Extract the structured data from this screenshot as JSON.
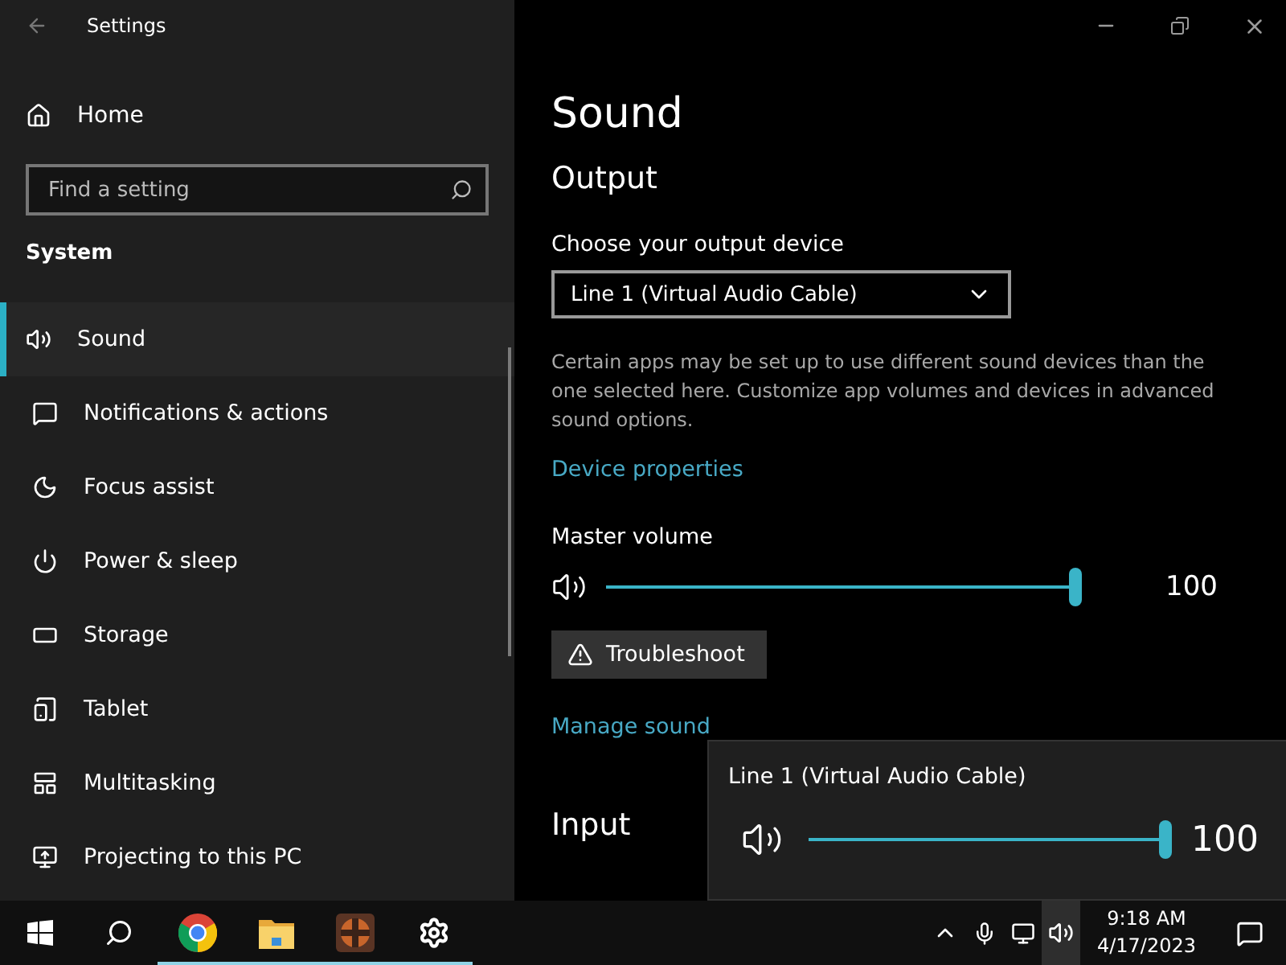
{
  "window": {
    "title": "Settings"
  },
  "sidebar": {
    "home": "Home",
    "search": {
      "placeholder": "Find a setting"
    },
    "section": "System",
    "items": [
      {
        "label": "Sound",
        "selected": true
      },
      {
        "label": "Notifications & actions",
        "selected": false
      },
      {
        "label": "Focus assist",
        "selected": false
      },
      {
        "label": "Power & sleep",
        "selected": false
      },
      {
        "label": "Storage",
        "selected": false
      },
      {
        "label": "Tablet",
        "selected": false
      },
      {
        "label": "Multitasking",
        "selected": false
      },
      {
        "label": "Projecting to this PC",
        "selected": false
      }
    ]
  },
  "main": {
    "title": "Sound",
    "output_heading": "Output",
    "device_label": "Choose your output device",
    "device_value": "Line 1 (Virtual Audio Cable)",
    "description": "Certain apps may be set up to use different sound devices than the one selected here. Customize app volumes and devices in advanced sound options.",
    "device_properties_link": "Device properties",
    "master_volume_label": "Master volume",
    "master_volume": {
      "level": 1.0,
      "reading": "100"
    },
    "troubleshoot_button": "Troubleshoot",
    "manage_link": "Manage sound",
    "input_heading": "Input"
  },
  "flyout": {
    "device": "Line 1 (Virtual Audio Cable)",
    "level": 1.0,
    "reading": "100"
  },
  "taskbar": {
    "apps": [
      {
        "kind": "start",
        "running": false
      },
      {
        "kind": "search",
        "running": false
      },
      {
        "kind": "browser",
        "running": true
      },
      {
        "kind": "folder",
        "running": true
      },
      {
        "kind": "game",
        "running": true
      },
      {
        "kind": "settings",
        "running": true
      }
    ],
    "tray": {
      "volume_selected": true,
      "time": "9:18 AM",
      "date": "4/17/2023"
    }
  }
}
